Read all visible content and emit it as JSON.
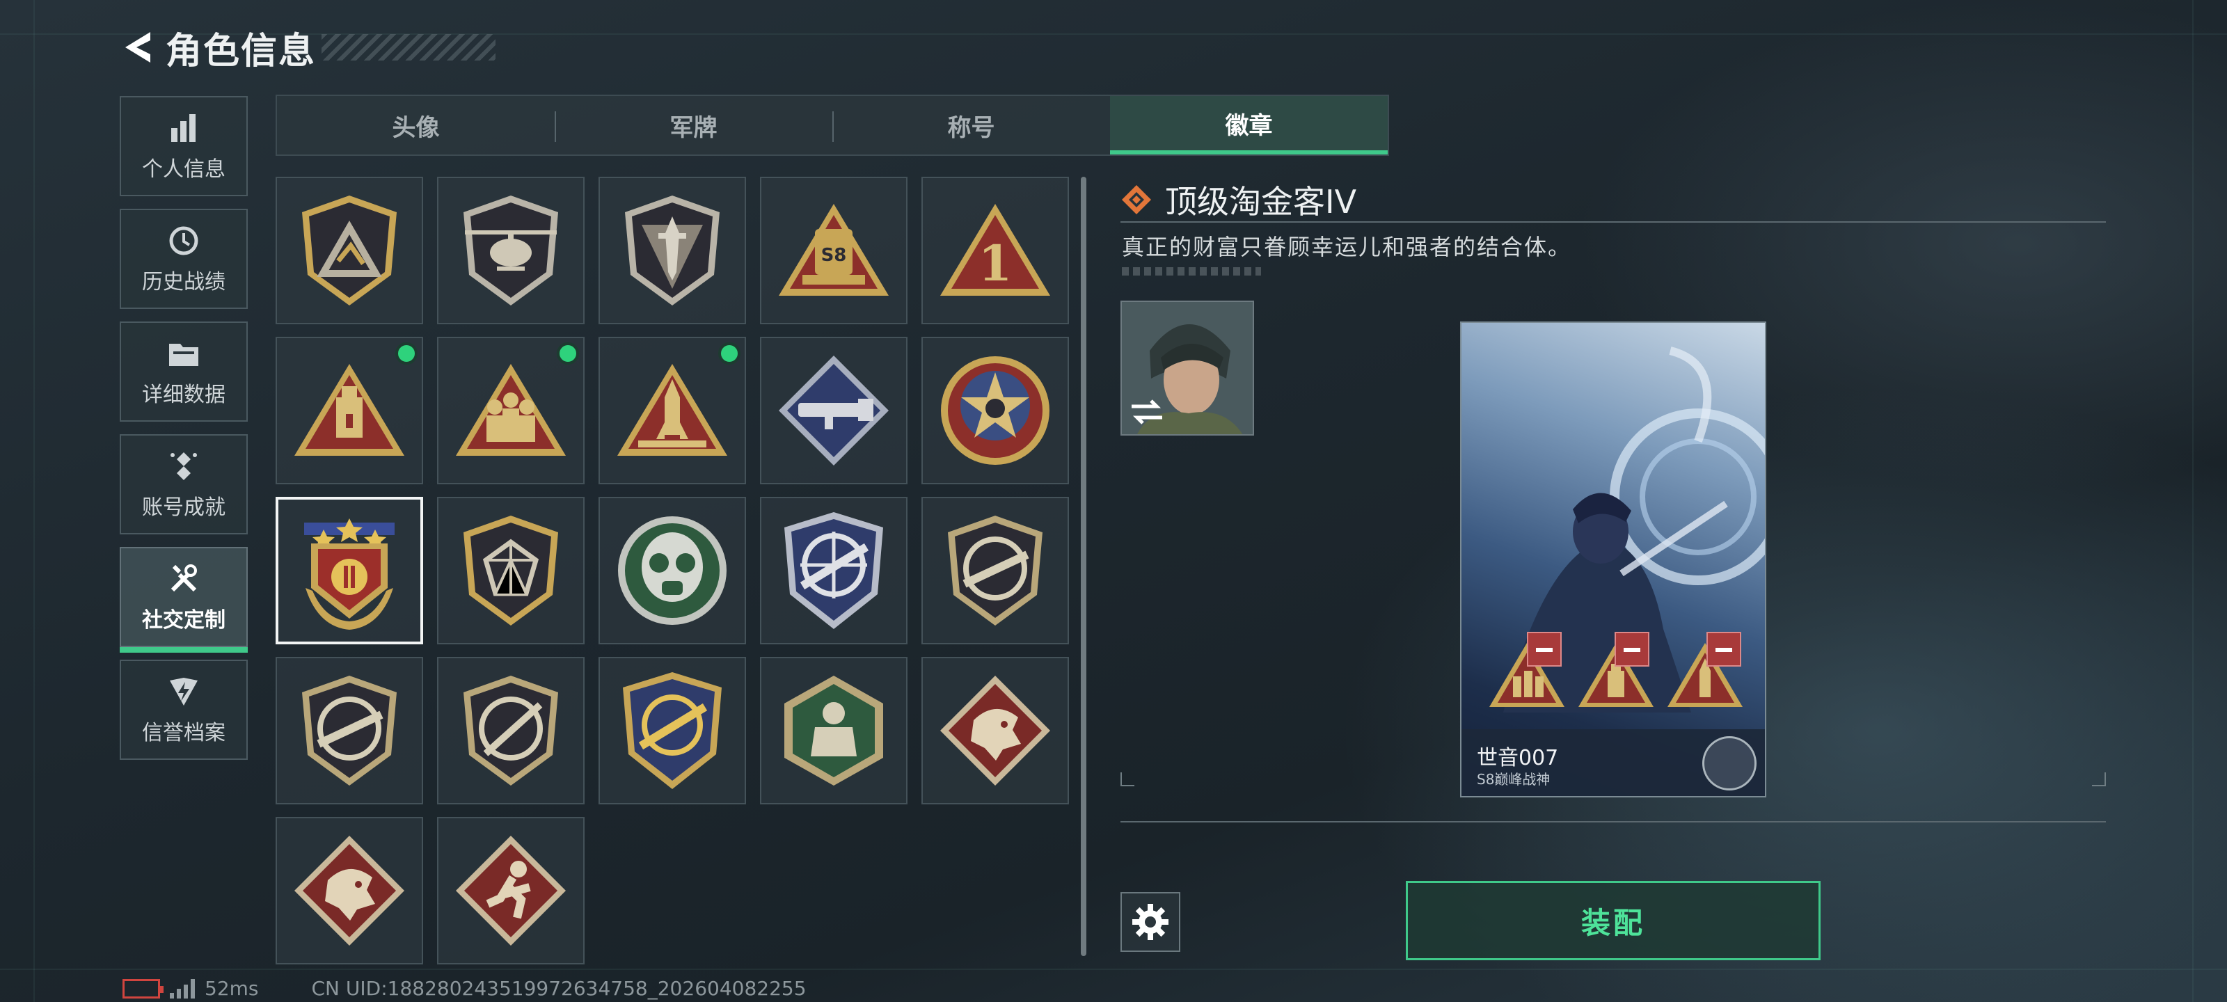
{
  "header": {
    "title": "角色信息"
  },
  "nav": {
    "items": [
      {
        "label": "个人信息",
        "icon": "bar-chart-icon",
        "active": false
      },
      {
        "label": "历史战绩",
        "icon": "history-clock-icon",
        "active": false
      },
      {
        "label": "详细数据",
        "icon": "folder-icon",
        "active": false
      },
      {
        "label": "账号成就",
        "icon": "achievement-icon",
        "active": false
      },
      {
        "label": "社交定制",
        "icon": "tools-icon",
        "active": true
      },
      {
        "label": "信誉档案",
        "icon": "shield-bolt-icon",
        "active": false
      }
    ]
  },
  "tabs": [
    {
      "label": "头像",
      "active": false
    },
    {
      "label": "军牌",
      "active": false
    },
    {
      "label": "称号",
      "active": false
    },
    {
      "label": "徽章",
      "active": true
    }
  ],
  "badges": [
    {
      "icon": "mountain-shield-badge-icon",
      "new": false,
      "selected": false
    },
    {
      "icon": "helicopter-badge-icon",
      "new": false,
      "selected": false
    },
    {
      "icon": "dagger-shield-badge-icon",
      "new": false,
      "selected": false
    },
    {
      "icon": "s8-triangle-badge-icon",
      "new": false,
      "selected": false
    },
    {
      "icon": "number-one-triangle-badge-icon",
      "new": false,
      "selected": false
    },
    {
      "icon": "usb-triangle-badge-icon",
      "new": true,
      "selected": false
    },
    {
      "icon": "soldiers-triangle-badge-icon",
      "new": true,
      "selected": false
    },
    {
      "icon": "rocket-triangle-badge-icon",
      "new": true,
      "selected": false
    },
    {
      "icon": "launcher-diamond-badge-icon",
      "new": false,
      "selected": false
    },
    {
      "icon": "star-skull-badge-icon",
      "new": false,
      "selected": false
    },
    {
      "icon": "stars-crest-badge-icon",
      "new": false,
      "selected": true
    },
    {
      "icon": "gem-shield-badge-icon",
      "new": false,
      "selected": false
    },
    {
      "icon": "mask-green-badge-icon",
      "new": false,
      "selected": false
    },
    {
      "icon": "rifle-crosshair-blue-badge-icon",
      "new": false,
      "selected": false
    },
    {
      "icon": "rifle-crosshair-dark-badge-icon",
      "new": false,
      "selected": false
    },
    {
      "icon": "rifle-crosshair-dark-2-badge-icon",
      "new": false,
      "selected": false
    },
    {
      "icon": "sniper-crosshair-badge-icon",
      "new": false,
      "selected": false
    },
    {
      "icon": "rifle-crosshair-gold-badge-icon",
      "new": false,
      "selected": false
    },
    {
      "icon": "muscle-hexagon-badge-icon",
      "new": false,
      "selected": false
    },
    {
      "icon": "dragon-diamond-badge-icon",
      "new": false,
      "selected": false
    },
    {
      "icon": "dragon-diamond-2-badge-icon",
      "new": false,
      "selected": false
    },
    {
      "icon": "runner-diamond-badge-icon",
      "new": false,
      "selected": false
    }
  ],
  "detail": {
    "title": "顶级淘金客IV",
    "description": "真正的财富只眷顾幸运儿和强者的结合体。",
    "card": {
      "name": "世音007",
      "subtitle": "S8巅峰战神"
    },
    "equip_label": "装配"
  },
  "status": {
    "ping": "52ms",
    "uid": "CN UID:1882802435199726347​58_202604082255"
  },
  "colors": {
    "accent": "#3fc98a",
    "badge_gold": "#c8a656",
    "badge_red": "#8c2f2a",
    "badge_dark": "#2b2b33"
  }
}
